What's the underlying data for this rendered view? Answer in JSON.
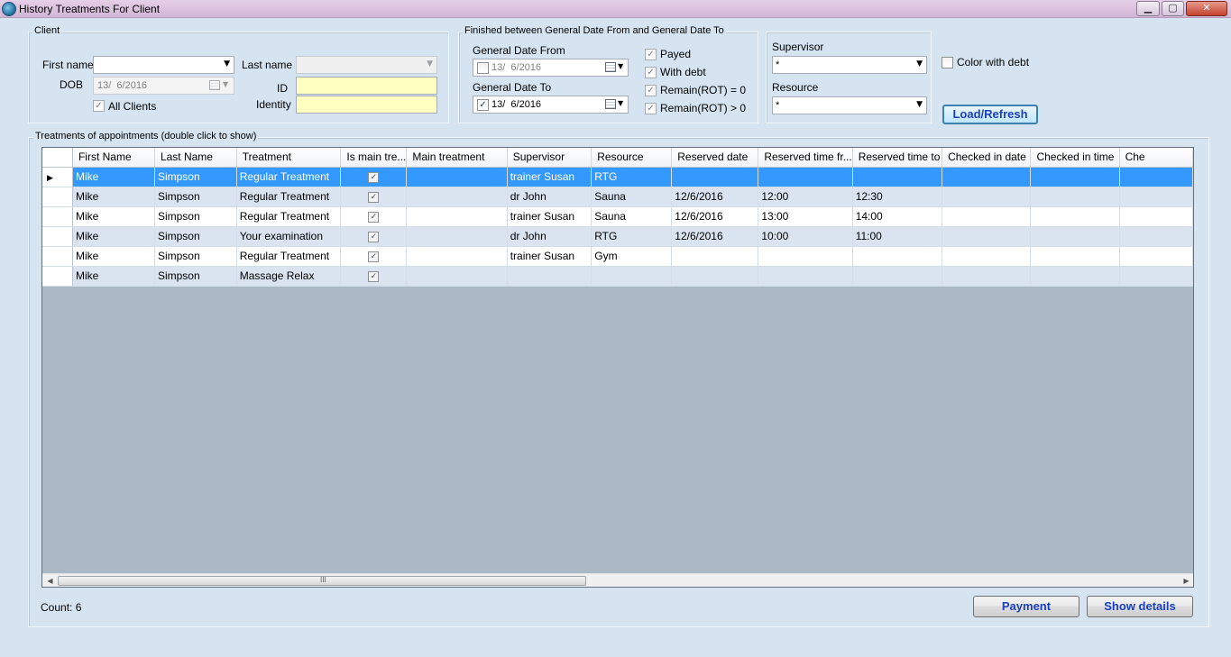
{
  "window": {
    "title": "History Treatments For Client",
    "minimize_glyph": "▁",
    "maximize_glyph": "▢",
    "close_glyph": "✕"
  },
  "client_group": {
    "label": "Client",
    "first_name_label": "First name",
    "first_name_value": "",
    "last_name_label": "Last name",
    "last_name_value": "",
    "dob_label": "DOB",
    "dob_value": "13/  6/2016",
    "id_label": "ID",
    "id_value": "",
    "identity_label": "Identity",
    "identity_value": "",
    "all_clients_label": "All Clients",
    "all_clients_checked": true
  },
  "finished_group": {
    "label": "Finished between General Date From and General Date To",
    "date_from_label": "General Date From",
    "date_from_value": "13/  6/2016",
    "date_from_checked": false,
    "date_to_label": "General Date To",
    "date_to_value": "13/  6/2016",
    "date_to_checked": true,
    "payed_label": "Payed",
    "with_debt_label": "With debt",
    "remain_eq_label": "Remain(ROT) = 0",
    "remain_gt_label": "Remain(ROT) > 0"
  },
  "filters": {
    "supervisor_label": "Supervisor",
    "supervisor_value": "*",
    "resource_label": "Resource",
    "resource_value": "*",
    "color_with_debt_label": "Color with debt",
    "load_refresh_label": "Load/Refresh"
  },
  "treatments": {
    "label": "Treatments of appointments (double click to show)",
    "columns": [
      "First Name",
      "Last Name",
      "Treatment",
      "Is main tre...",
      "Main treatment",
      "Supervisor",
      "Resource",
      "Reserved date",
      "Reserved time fr...",
      "Reserved time to",
      "Checked in date",
      "Checked in time",
      "Che"
    ],
    "rows": [
      {
        "first": "Mike",
        "last": "Simpson",
        "treatment": "Regular Treatment",
        "is_main": true,
        "main_treatment": "",
        "supervisor": "trainer Susan",
        "resource": "RTG",
        "reserved_date": "",
        "time_from": "",
        "time_to": "",
        "checkin_date": "",
        "checkin_time": "",
        "che": ""
      },
      {
        "first": "Mike",
        "last": "Simpson",
        "treatment": "Regular Treatment",
        "is_main": true,
        "main_treatment": "",
        "supervisor": "dr John",
        "resource": "Sauna",
        "reserved_date": "12/6/2016",
        "time_from": "12:00",
        "time_to": "12:30",
        "checkin_date": "",
        "checkin_time": "",
        "che": ""
      },
      {
        "first": "Mike",
        "last": "Simpson",
        "treatment": "Regular Treatment",
        "is_main": true,
        "main_treatment": "",
        "supervisor": "trainer Susan",
        "resource": "Sauna",
        "reserved_date": "12/6/2016",
        "time_from": "13:00",
        "time_to": "14:00",
        "checkin_date": "",
        "checkin_time": "",
        "che": ""
      },
      {
        "first": "Mike",
        "last": "Simpson",
        "treatment": "Your examination",
        "is_main": true,
        "main_treatment": "",
        "supervisor": "dr John",
        "resource": "RTG",
        "reserved_date": "12/6/2016",
        "time_from": "10:00",
        "time_to": "11:00",
        "checkin_date": "",
        "checkin_time": "",
        "che": ""
      },
      {
        "first": "Mike",
        "last": "Simpson",
        "treatment": "Regular Treatment",
        "is_main": true,
        "main_treatment": "",
        "supervisor": "trainer Susan",
        "resource": "Gym",
        "reserved_date": "",
        "time_from": "",
        "time_to": "",
        "checkin_date": "",
        "checkin_time": "",
        "che": ""
      },
      {
        "first": "Mike",
        "last": "Simpson",
        "treatment": "Massage Relax",
        "is_main": true,
        "main_treatment": "",
        "supervisor": "",
        "resource": "",
        "reserved_date": "",
        "time_from": "",
        "time_to": "",
        "checkin_date": "",
        "checkin_time": "",
        "che": ""
      }
    ],
    "count_text": "Count: 6",
    "scroll_grip": "III"
  },
  "footer": {
    "payment_label": "Payment",
    "show_details_label": "Show details"
  },
  "colors": {
    "background": "#d6e3f0",
    "selection": "#3399ff",
    "alt_row": "#d9e4f0",
    "button_text": "#1a3fbf",
    "required_field": "#ffffc0"
  }
}
